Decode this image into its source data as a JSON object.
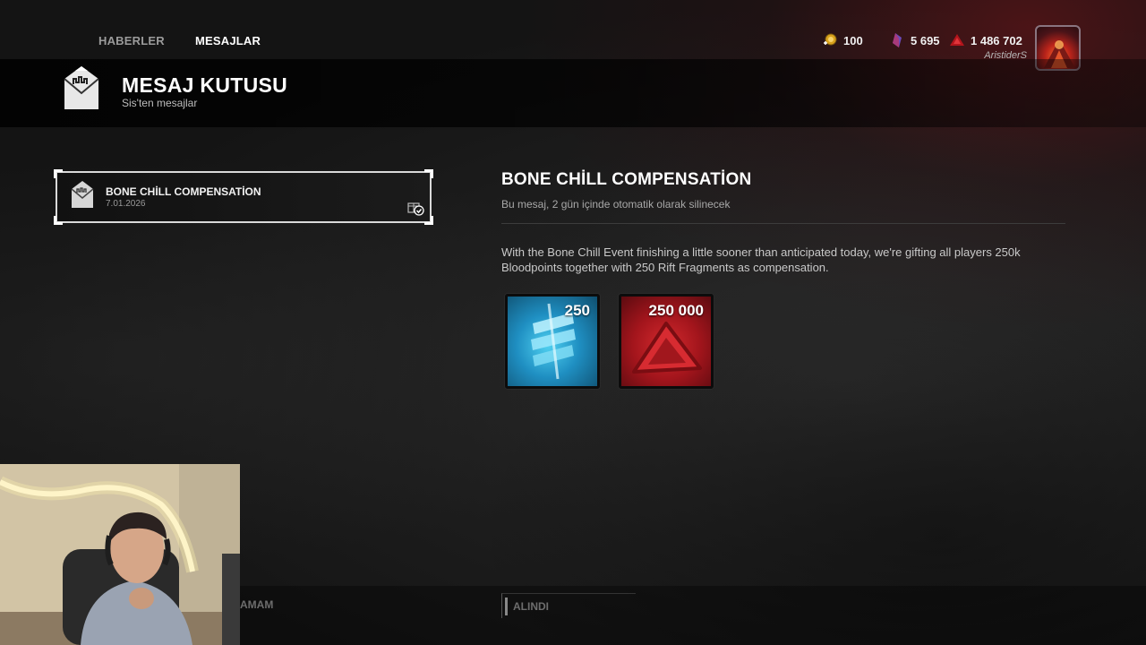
{
  "nav": {
    "tabs": [
      {
        "label": "HABERLER",
        "active": false
      },
      {
        "label": "MESAJLAR",
        "active": true
      }
    ]
  },
  "currencies": [
    {
      "icon": "auric-cells-icon",
      "value": "100"
    },
    {
      "icon": "iridescent-shards-icon",
      "value": "5 695"
    },
    {
      "icon": "bloodpoints-icon",
      "value": "1 486 702"
    }
  ],
  "profile": {
    "username": "AristiderS",
    "avatar": "player-avatar"
  },
  "header": {
    "title": "MESAJ KUTUSU",
    "subtitle": "Sis'ten mesajlar"
  },
  "messages": [
    {
      "title": "BONE CHİLL COMPENSATİON",
      "date": "7.01.2026",
      "status": "claimed",
      "selected": true
    }
  ],
  "detail": {
    "title": "BONE CHİLL COMPENSATİON",
    "expires": "Bu mesaj, 2 gün içinde otomatik olarak silinecek",
    "body": "With the Bone Chill Event finishing a little sooner than anticipated today, we're gifting all players 250k Bloodpoints together with 250 Rift Fragments as compensation.",
    "rewards": [
      {
        "name": "rift-fragments",
        "amount": "250",
        "color": "#2fa6d8"
      },
      {
        "name": "bloodpoints",
        "amount": "250 000",
        "color": "#c21d24"
      }
    ]
  },
  "footer": {
    "ok_label": "AMAM",
    "claimed_label": "ALINDI"
  },
  "colors": {
    "accent_red": "#c21d24",
    "accent_blue": "#2fa6d8",
    "background": "#161616"
  }
}
